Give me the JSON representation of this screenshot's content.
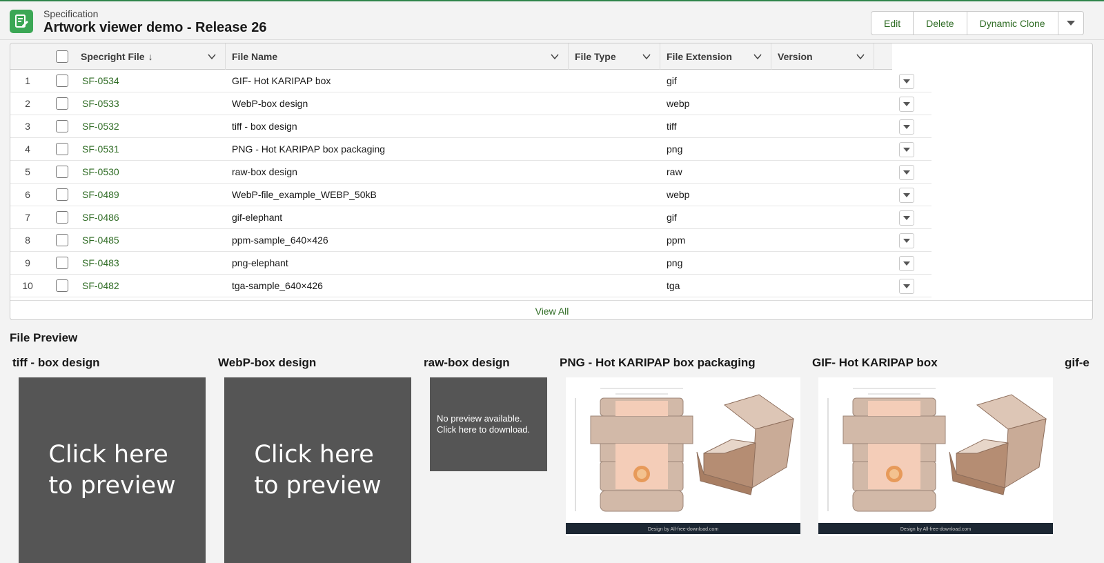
{
  "header": {
    "object_label": "Specification",
    "record_title": "Artwork viewer demo - Release 26",
    "actions": [
      "Edit",
      "Delete",
      "Dynamic Clone"
    ]
  },
  "table": {
    "columns": [
      "Specright File",
      "File Name",
      "File Type",
      "File Extension",
      "Version"
    ],
    "sort_indicator": "↓",
    "rows": [
      {
        "num": "1",
        "id": "SF-0534",
        "name": "GIF- Hot KARIPAP box",
        "type": "",
        "ext": "gif",
        "version": ""
      },
      {
        "num": "2",
        "id": "SF-0533",
        "name": "WebP-box design",
        "type": "",
        "ext": "webp",
        "version": ""
      },
      {
        "num": "3",
        "id": "SF-0532",
        "name": "tiff - box design",
        "type": "",
        "ext": "tiff",
        "version": ""
      },
      {
        "num": "4",
        "id": "SF-0531",
        "name": "PNG - Hot KARIPAP box packaging",
        "type": "",
        "ext": "png",
        "version": ""
      },
      {
        "num": "5",
        "id": "SF-0530",
        "name": "raw-box design",
        "type": "",
        "ext": "raw",
        "version": ""
      },
      {
        "num": "6",
        "id": "SF-0489",
        "name": "WebP-file_example_WEBP_50kB",
        "type": "",
        "ext": "webp",
        "version": ""
      },
      {
        "num": "7",
        "id": "SF-0486",
        "name": "gif-elephant",
        "type": "",
        "ext": "gif",
        "version": ""
      },
      {
        "num": "8",
        "id": "SF-0485",
        "name": "ppm-sample_640×426",
        "type": "",
        "ext": "ppm",
        "version": ""
      },
      {
        "num": "9",
        "id": "SF-0483",
        "name": "png-elephant",
        "type": "",
        "ext": "png",
        "version": ""
      },
      {
        "num": "10",
        "id": "SF-0482",
        "name": "tga-sample_640×426",
        "type": "",
        "ext": "tga",
        "version": ""
      }
    ],
    "view_all": "View All"
  },
  "preview": {
    "title": "File Preview",
    "items": [
      {
        "title": "tiff - box design",
        "line1": "Click here",
        "line2": "to preview"
      },
      {
        "title": "WebP-box design",
        "line1": "Click here",
        "line2": "to preview"
      },
      {
        "title": "raw-box design",
        "line1": "No preview available.",
        "line2": "Click here to download."
      },
      {
        "title": "PNG - Hot KARIPAP box packaging",
        "credit": "Design by All-free-download.com"
      },
      {
        "title": "GIF- Hot KARIPAP box",
        "credit": "Design by All-free-download.com"
      },
      {
        "title": "gif-e"
      }
    ]
  },
  "colors": {
    "brand": "#2e844a",
    "link": "#2e6b23",
    "tile": "#555555",
    "box_kraft": "#d2b9a8"
  }
}
